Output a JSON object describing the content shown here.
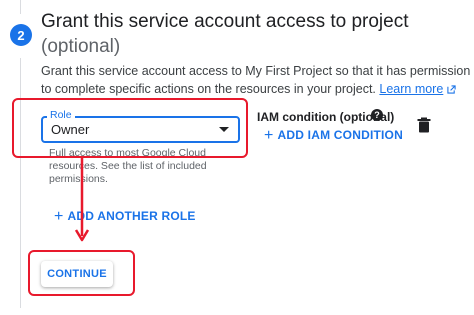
{
  "step": {
    "number": "2",
    "title": "Grant this service account access to project",
    "subtitle": "(optional)",
    "description": "Grant this service account access to My First Project so that it has permission to complete specific actions on the resources in your project.",
    "learn_more": "Learn more"
  },
  "role_field": {
    "label": "Role",
    "value": "Owner",
    "help_text": "Full access to most Google Cloud resources. See the list of included permissions."
  },
  "iam_condition": {
    "label": "IAM condition (optional)",
    "add_button": "ADD IAM CONDITION"
  },
  "actions": {
    "add_another_role": "ADD ANOTHER ROLE",
    "continue": "CONTINUE"
  },
  "colors": {
    "accent": "#1a73e8",
    "highlight": "#e8192c"
  },
  "icons": [
    "help-icon",
    "trash-icon",
    "external-link-icon",
    "add-icon",
    "dropdown-arrow-icon"
  ]
}
